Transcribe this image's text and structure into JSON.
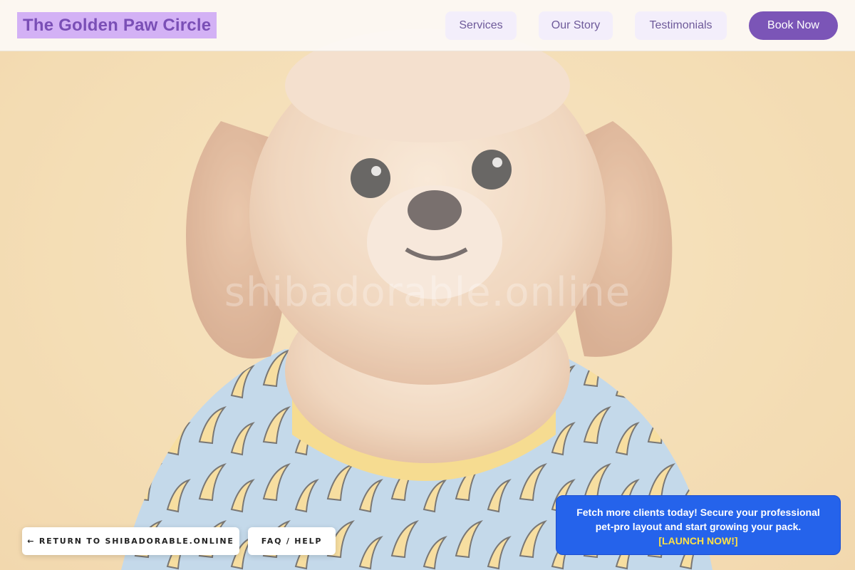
{
  "header": {
    "brand": "The Golden Paw Circle",
    "nav": [
      {
        "label": "Services"
      },
      {
        "label": "Our Story"
      },
      {
        "label": "Testimonials"
      }
    ],
    "cta_label": "Book Now"
  },
  "hero": {
    "watermark": "shibadorable.online",
    "image": "fluffy-dog-in-banana-shirt"
  },
  "footer_buttons": {
    "return_label": "← RETURN TO SHIBADORABLE.ONLINE",
    "faq_label": "FAQ / HELP"
  },
  "promo": {
    "line1": "Fetch more clients today! Secure your professional",
    "line2": "pet-pro layout and start growing your pack.",
    "cta": "[LAUNCH NOW!]"
  },
  "colors": {
    "accent": "#7b55b7",
    "brand_highlight": "#d3b1f5",
    "promo_bg": "#2563eb",
    "promo_cta": "#fde047",
    "background": "#f2d9a4"
  }
}
